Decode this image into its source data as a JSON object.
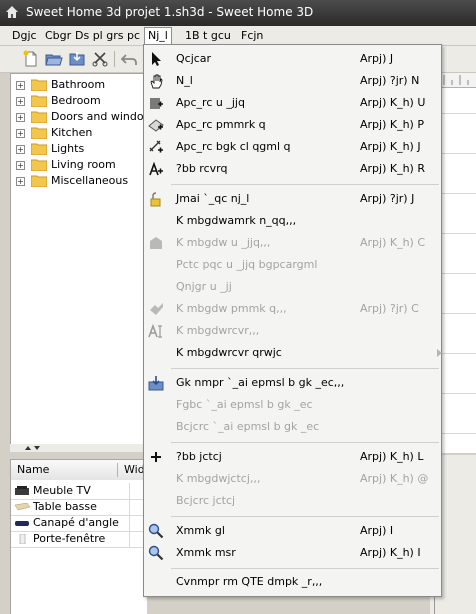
{
  "window": {
    "title": "Sweet Home 3d projet 1.sh3d - Sweet Home 3D"
  },
  "menubar": {
    "items": [
      {
        "label": "Dgjc"
      },
      {
        "label": "Cbgr"
      },
      {
        "label": "Ds pl grs pc"
      },
      {
        "label": "Nj_l"
      },
      {
        "label": "1B t gcu"
      },
      {
        "label": "Fcjn"
      }
    ]
  },
  "toolbar": {
    "icons": [
      "new-icon",
      "open-icon",
      "save-icon",
      "cut-icon",
      "undo-icon"
    ]
  },
  "catalog": {
    "categories": [
      {
        "label": "Bathroom"
      },
      {
        "label": "Bedroom"
      },
      {
        "label": "Doors and windows"
      },
      {
        "label": "Kitchen"
      },
      {
        "label": "Lights"
      },
      {
        "label": "Living room"
      },
      {
        "label": "Miscellaneous"
      }
    ]
  },
  "furniture": {
    "headers": {
      "name": "Name",
      "width": "Wid"
    },
    "rows": [
      {
        "label": "Meuble TV"
      },
      {
        "label": "Table basse"
      },
      {
        "label": "Canapé d'angle"
      },
      {
        "label": "Porte-fenêtre"
      }
    ]
  },
  "plan_menu": {
    "items": [
      {
        "label": "Qcjcar",
        "accel": "Arpj) J",
        "icon": "arrow-select-icon",
        "enabled": true
      },
      {
        "label": "N_l",
        "accel": "Arpj) ?jr) N",
        "icon": "pan-hand-icon",
        "enabled": true
      },
      {
        "label": "Apc_rc u _jjq",
        "accel": "Arpj) K_h) U",
        "icon": "create-walls-icon",
        "enabled": true
      },
      {
        "label": "Apc_rc pmmrk q",
        "accel": "Arpj) K_h) P",
        "icon": "create-rooms-icon",
        "enabled": true
      },
      {
        "label": "Apc_rc bgk cl qgml q",
        "accel": "Arpj) K_h) J",
        "icon": "create-dimensions-icon",
        "enabled": true
      },
      {
        "label": "?bb rcvrq",
        "accel": "Arpj) K_h) R",
        "icon": "add-text-icon",
        "enabled": true
      },
      {
        "label": "Jmai `_qc nj_l",
        "accel": "Arpj) ?jr) J",
        "icon": "lock-icon",
        "enabled": true
      },
      {
        "label": "K mbgdwamrk n_qq,,,",
        "accel": "",
        "icon": "",
        "enabled": true
      },
      {
        "label": "K mbgdw u _jjq,,,",
        "accel": "Arpj) K_h) C",
        "icon": "modify-walls-icon",
        "enabled": false
      },
      {
        "label": "Pctc pqc u _jjq bgpcargml",
        "accel": "",
        "icon": "",
        "enabled": false
      },
      {
        "label": "Qnjgr u _jj",
        "accel": "",
        "icon": "",
        "enabled": false
      },
      {
        "label": "K mbgdw pmmk q,,,",
        "accel": "Arpj) ?jr) C",
        "icon": "modify-rooms-icon",
        "enabled": false
      },
      {
        "label": "K mbgdwrcvr,,,",
        "accel": "",
        "icon": "modify-text-icon",
        "enabled": false
      },
      {
        "label": "K mbgdwrcvr qrwjc",
        "accel": "",
        "icon": "",
        "enabled": true,
        "submenu": true
      },
      {
        "label": "Gk nmpr `_ai epmsl b gk _ec,,,",
        "accel": "",
        "icon": "import-background-icon",
        "enabled": true
      },
      {
        "label": "Fgbc `_ai epmsl b gk _ec",
        "accel": "",
        "icon": "",
        "enabled": false
      },
      {
        "label": "Bcjcrc `_ai epmsl b gk _ec",
        "accel": "",
        "icon": "",
        "enabled": false
      },
      {
        "label": "?bb jctcj",
        "accel": "Arpj) K_h) L",
        "icon": "add-level-icon",
        "enabled": true
      },
      {
        "label": "K mbgdwjctcj,,,",
        "accel": "Arpj) K_h) @",
        "icon": "",
        "enabled": false
      },
      {
        "label": "Bcjcrc jctcj",
        "accel": "",
        "icon": "",
        "enabled": false
      },
      {
        "label": "Xmmk gl",
        "accel": "Arpj) I",
        "icon": "zoom-in-icon",
        "enabled": true
      },
      {
        "label": "Xmmk msr",
        "accel": "Arpj) K_h) I",
        "icon": "zoom-out-icon",
        "enabled": true
      },
      {
        "label": "Cvnmpr rm QTE dmpk _r,,,",
        "accel": "",
        "icon": "",
        "enabled": true
      }
    ]
  }
}
